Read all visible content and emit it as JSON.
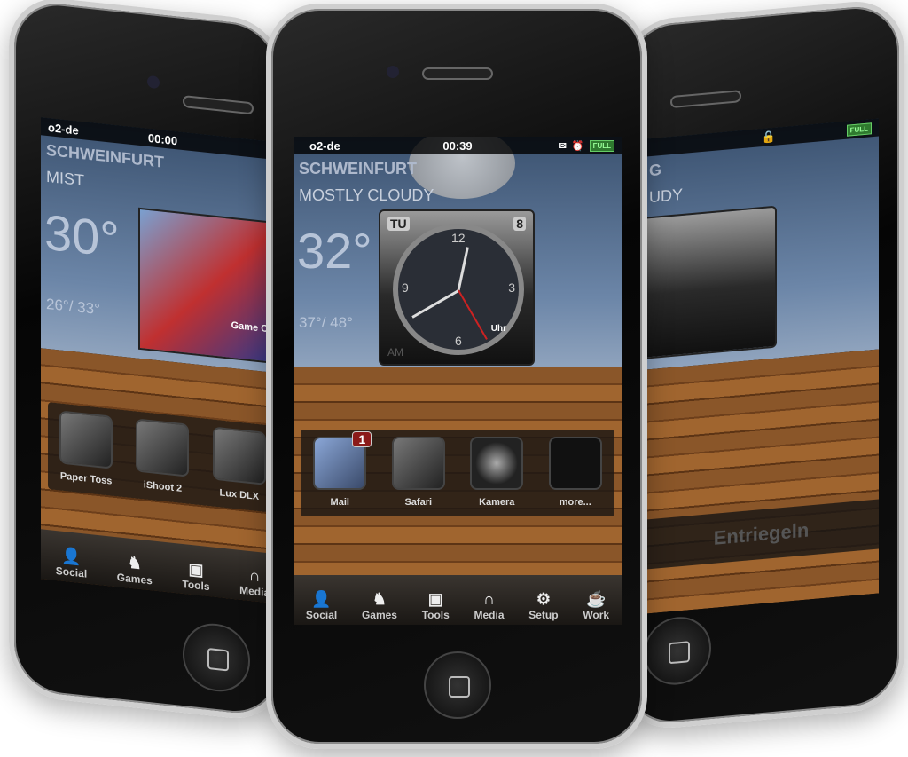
{
  "left_phone": {
    "status": {
      "carrier": "o2-de",
      "time": "00:00"
    },
    "weather": {
      "city": "SCHWEINFURT",
      "condition": "MIST",
      "temp": "30°",
      "range": "26°/ 33°"
    },
    "widget_label": "Game Cen",
    "dock": [
      {
        "label": "Paper Toss"
      },
      {
        "label": "iShoot 2"
      },
      {
        "label": "Lux DLX"
      }
    ],
    "tabs": [
      {
        "label": "Social",
        "icon": "person-icon"
      },
      {
        "label": "Games",
        "icon": "chess-knight-icon"
      },
      {
        "label": "Tools",
        "icon": "toolbox-icon"
      },
      {
        "label": "Media",
        "icon": "headphones-icon"
      }
    ]
  },
  "center_phone": {
    "status": {
      "carrier": "o2-de",
      "time": "00:39",
      "battery": "FULL"
    },
    "weather": {
      "city": "SCHWEINFURT",
      "condition": "MOSTLY CLOUDY",
      "temp": "32°",
      "range": "37°/ 48°"
    },
    "clock": {
      "day": "TU",
      "date": "8",
      "brand": "Uhr",
      "ampm": "AM",
      "numerals": [
        "12",
        "3",
        "6",
        "9"
      ]
    },
    "dock": [
      {
        "label": "Mail",
        "badge": "1"
      },
      {
        "label": "Safari"
      },
      {
        "label": "Kamera"
      },
      {
        "label": "more..."
      }
    ],
    "tabs": [
      {
        "label": "Social",
        "icon": "person-icon"
      },
      {
        "label": "Games",
        "icon": "chess-knight-icon"
      },
      {
        "label": "Tools",
        "icon": "toolbox-icon"
      },
      {
        "label": "Media",
        "icon": "headphones-icon"
      },
      {
        "label": "Setup",
        "icon": "gear-icon"
      },
      {
        "label": "Work",
        "icon": "coffee-cup-icon"
      }
    ]
  },
  "right_phone": {
    "status": {
      "battery": "FULL"
    },
    "weather": {
      "city": "G",
      "condition": "UDY"
    },
    "unlock_label": "Entriegeln"
  }
}
